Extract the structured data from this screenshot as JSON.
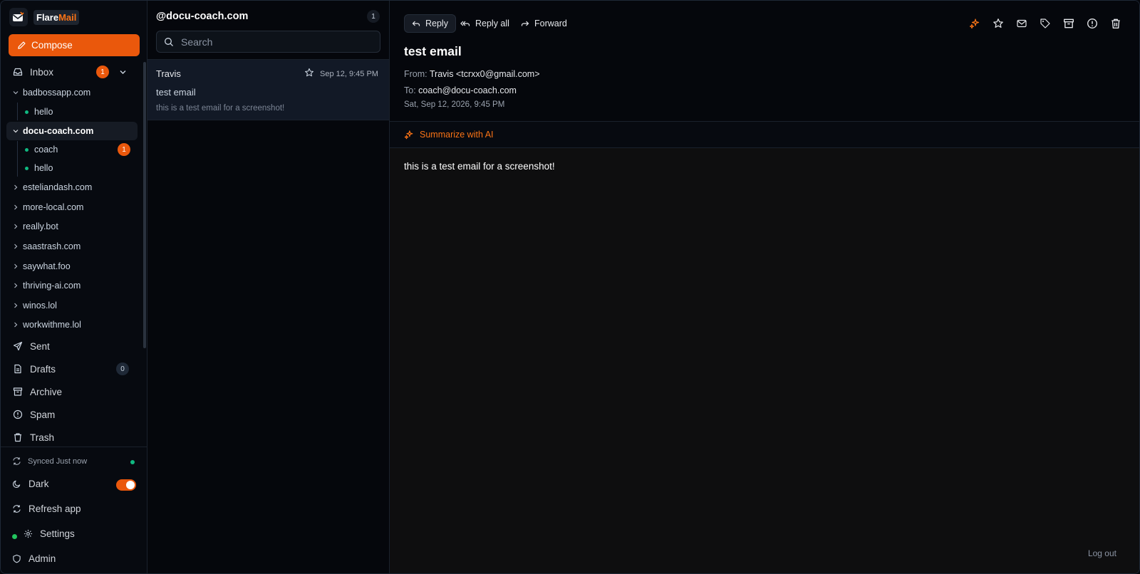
{
  "app": {
    "logo_prefix": "Flare",
    "logo_accent": "Mail",
    "accent_color": "#ea580c"
  },
  "sidebar": {
    "compose_label": "Compose",
    "inbox": {
      "label": "Inbox",
      "badge": "1"
    },
    "domains": [
      {
        "name": "badbossapp.com",
        "expanded": true,
        "subs": [
          {
            "label": "hello"
          }
        ]
      },
      {
        "name": "docu-coach.com",
        "expanded": true,
        "selected": true,
        "subs": [
          {
            "label": "coach",
            "badge": "1"
          },
          {
            "label": "hello"
          }
        ]
      },
      {
        "name": "esteliandash.com"
      },
      {
        "name": "more-local.com"
      },
      {
        "name": "really.bot"
      },
      {
        "name": "saastrash.com"
      },
      {
        "name": "saywhat.foo"
      },
      {
        "name": "thriving-ai.com"
      },
      {
        "name": "winos.lol"
      },
      {
        "name": "workwithme.lol"
      }
    ],
    "folders": {
      "sent": "Sent",
      "drafts": {
        "label": "Drafts",
        "badge": "0"
      },
      "archive": "Archive",
      "spam": "Spam",
      "trash": "Trash"
    },
    "bottom": {
      "synced": "Synced Just now",
      "dark": "Dark",
      "refresh": "Refresh app",
      "settings": "Settings",
      "admin": "Admin"
    }
  },
  "list": {
    "title": "@docu-coach.com",
    "count": "1",
    "search_placeholder": "Search",
    "messages": [
      {
        "sender": "Travis",
        "date": "Sep 12, 9:45 PM",
        "subject": "test email",
        "preview": "this is a test email for a screenshot!"
      }
    ]
  },
  "reader": {
    "reply": "Reply",
    "reply_all": "Reply all",
    "forward": "Forward",
    "subject": "test email",
    "from_label": "From:",
    "from_value": "Travis <tcrxx0@gmail.com>",
    "to_label": "To:",
    "to_value": "coach@docu-coach.com",
    "datetime": "Sat, Sep 12, 2026, 9:45 PM",
    "summarize": "Summarize with AI",
    "body": "this is a test email for a screenshot!",
    "logout": "Log out",
    "toolbar_icons": [
      "sparkles-icon",
      "star-icon",
      "mail-icon",
      "tag-icon",
      "archive-icon",
      "alert-icon",
      "trash-icon"
    ]
  }
}
